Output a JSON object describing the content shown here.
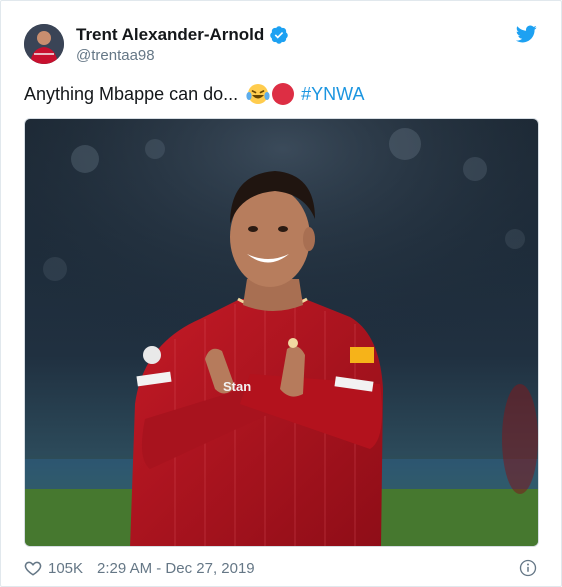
{
  "tweet": {
    "display_name": "Trent Alexander-Arnold",
    "handle": "@trentaa98",
    "text": "Anything Mbappe can do...",
    "hashtag": "#YNWA",
    "likes": "105K",
    "timestamp": "2:29 AM - Dec 27, 2019"
  },
  "icons": {
    "verified": "verified-badge-icon",
    "twitter": "twitter-bird-icon",
    "laugh_emoji": "face-with-tears-of-joy-icon",
    "red_circle": "red-circle-icon",
    "like": "heart-icon",
    "info": "info-icon"
  },
  "colors": {
    "verified_blue": "#1da1f2",
    "hashtag_blue": "#1b95e0",
    "muted_text": "#657786",
    "kit_red": "#b3121d"
  }
}
